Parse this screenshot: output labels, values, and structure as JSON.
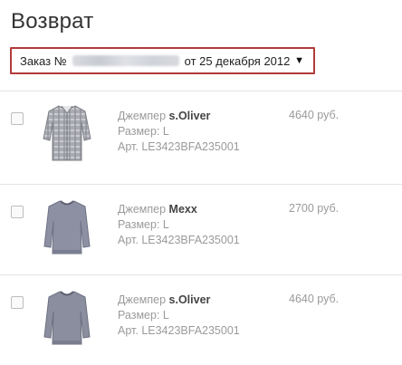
{
  "page": {
    "title": "Возврат"
  },
  "order_select": {
    "prefix": "Заказ №",
    "date_text": "от 25 декабря 2012",
    "caret": "▼"
  },
  "items": [
    {
      "type": "Джемпер",
      "brand": "s.Oliver",
      "size_label": "Размер:",
      "size": "L",
      "article_label": "Арт.",
      "article": "LE3423BFA235001",
      "price": "4640 руб.",
      "thumb": "plaid-shirt-icon"
    },
    {
      "type": "Джемпер",
      "brand": "Mexx",
      "size_label": "Размер:",
      "size": "L",
      "article_label": "Арт.",
      "article": "LE3423BFA235001",
      "price": "2700 руб.",
      "thumb": "sweater-icon"
    },
    {
      "type": "Джемпер",
      "brand": "s.Oliver",
      "size_label": "Размер:",
      "size": "L",
      "article_label": "Арт.",
      "article": "LE3423BFA235001",
      "price": "4640 руб.",
      "thumb": "sweater-icon"
    }
  ],
  "colors": {
    "accent_border": "#b23a3a",
    "muted_text": "#9a9a9a",
    "divider": "#e4e4e4"
  }
}
